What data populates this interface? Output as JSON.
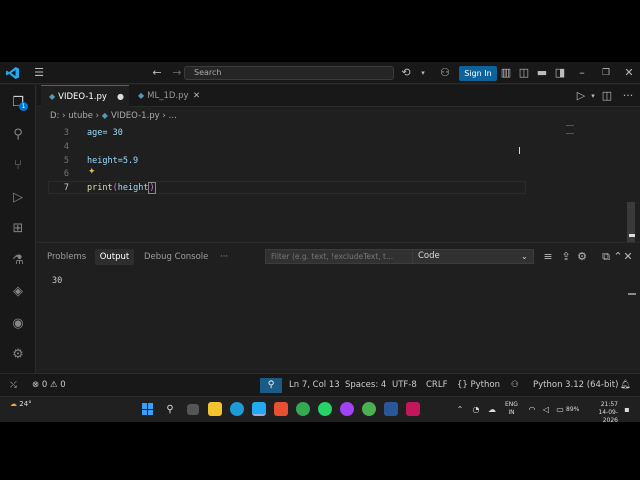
{
  "titlebar": {
    "search_placeholder": "Search",
    "sign_in": "Sign In"
  },
  "activity": {
    "explorer_badge": "1"
  },
  "tabs": [
    {
      "label": "VIDEO-1.py",
      "active": true
    },
    {
      "label": "ML_1D.py",
      "active": false
    }
  ],
  "breadcrumb": {
    "drive": "D:",
    "sep": "›",
    "folder": "utube",
    "file": "VIDEO-1.py",
    "ellipsis": "…"
  },
  "editor": {
    "lines": [
      {
        "num": "3",
        "code": "age= 30"
      },
      {
        "num": "4",
        "code": ""
      },
      {
        "num": "5",
        "code": "height=5.9"
      },
      {
        "num": "6",
        "code": ""
      },
      {
        "num": "7",
        "code_func": "print",
        "code_open": "(",
        "code_arg": "height",
        "code_close": ")"
      }
    ],
    "suggestion": "height"
  },
  "panel": {
    "tabs": [
      "Problems",
      "Output",
      "Debug Console"
    ],
    "active_tab": "Output",
    "more": "···",
    "filter_placeholder": "Filter (e.g. text, !excludeText, t...",
    "channel": "Code",
    "output": "30"
  },
  "statusbar": {
    "errors": "0",
    "warnings": "0",
    "position": "Ln 7, Col 13",
    "spaces": "Spaces: 4",
    "encoding": "UTF-8",
    "eol": "CRLF",
    "language": "Python",
    "interpreter": "Python 3.12 (64-bit)"
  },
  "taskbar": {
    "weather": "24°",
    "lang_top": "ENG",
    "lang_bottom": "IN",
    "battery": "89%",
    "time": "21:57",
    "date": "14-09-2026"
  },
  "colors": {
    "accent": "#0078d4",
    "keyword_func": "#dcdcaa",
    "variable": "#9cdcfe",
    "number": "#b5cea8"
  }
}
